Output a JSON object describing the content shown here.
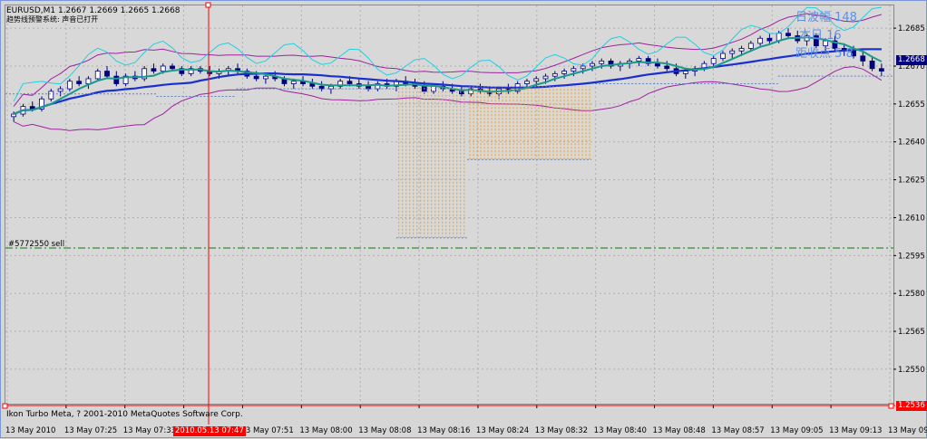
{
  "header": {
    "symbol_line": "EURUSD,M1  1.2667 1.2669 1.2665 1.2668",
    "indicator_line": "趋势线预警系统: 声音已打开"
  },
  "overlay_text": {
    "line1": "日波幅 148",
    "line2": "本日 16",
    "line3": "距收点 5 8"
  },
  "order_label": "#5772550 sell",
  "footer_text": "Ikon Turbo Meta, ? 2001-2010 MetaQuotes Software Corp.",
  "crosshair_time": "2010.05.13 07:47",
  "current_price_tag": "1.2668",
  "cursor_price_tag": "1.2536",
  "colors": {
    "candle_up_fill": "#ffffff",
    "candle_down_fill": "#000080",
    "candle_outline": "#000080",
    "ma_fast": "#1a9a8a",
    "ma_slow": "#1a2fd0",
    "bollinger": "#a020a0",
    "envelope_cyan": "#20d0e0",
    "dotted_orange": "#f0a020",
    "dotted_blue": "#6080c0",
    "order_line": "#008000",
    "crosshair": "#ff0000"
  },
  "chart_data": {
    "type": "candlestick",
    "title": "EURUSD,M1",
    "ylim": [
      1.2536,
      1.2694
    ],
    "y_ticks": [
      "1.2685",
      "1.2670",
      "1.2655",
      "1.2640",
      "1.2625",
      "1.2610",
      "1.2595",
      "1.2580",
      "1.2565",
      "1.2550"
    ],
    "x_ticks": [
      "13 May 2010",
      "13 May 07:25",
      "13 May 07:33",
      "13 May 07:42",
      "13 May 07:51",
      "13 May 08:00",
      "13 May 08:08",
      "13 May 08:16",
      "13 May 08:24",
      "13 May 08:32",
      "13 May 08:40",
      "13 May 08:48",
      "13 May 08:57",
      "13 May 09:05",
      "13 May 09:13",
      "13 May 09:21"
    ],
    "order_sell_price": 1.2598,
    "candles": [
      [
        1.265,
        1.2652,
        1.2648,
        1.2651
      ],
      [
        1.2651,
        1.2655,
        1.265,
        1.2654
      ],
      [
        1.2654,
        1.2656,
        1.2652,
        1.2653
      ],
      [
        1.2653,
        1.2658,
        1.2652,
        1.2657
      ],
      [
        1.2657,
        1.2661,
        1.2656,
        1.266
      ],
      [
        1.266,
        1.2662,
        1.2658,
        1.2661
      ],
      [
        1.2661,
        1.2665,
        1.266,
        1.2664
      ],
      [
        1.2664,
        1.2666,
        1.2662,
        1.2663
      ],
      [
        1.2663,
        1.2666,
        1.2661,
        1.2665
      ],
      [
        1.2665,
        1.2669,
        1.2664,
        1.2668
      ],
      [
        1.2668,
        1.267,
        1.2665,
        1.2666
      ],
      [
        1.2666,
        1.2668,
        1.2662,
        1.2663
      ],
      [
        1.2663,
        1.2667,
        1.2662,
        1.2666
      ],
      [
        1.2666,
        1.2668,
        1.2664,
        1.2665
      ],
      [
        1.2665,
        1.267,
        1.2664,
        1.2669
      ],
      [
        1.2669,
        1.2671,
        1.2667,
        1.2668
      ],
      [
        1.2668,
        1.2671,
        1.2667,
        1.267
      ],
      [
        1.267,
        1.2671,
        1.2668,
        1.2669
      ],
      [
        1.2669,
        1.267,
        1.2666,
        1.2667
      ],
      [
        1.2667,
        1.267,
        1.2666,
        1.2669
      ],
      [
        1.2669,
        1.267,
        1.2667,
        1.2668
      ],
      [
        1.2668,
        1.267,
        1.2666,
        1.2667
      ],
      [
        1.2667,
        1.2669,
        1.2665,
        1.2668
      ],
      [
        1.2668,
        1.267,
        1.2666,
        1.2669
      ],
      [
        1.2669,
        1.2671,
        1.2667,
        1.2668
      ],
      [
        1.2668,
        1.2669,
        1.2665,
        1.2666
      ],
      [
        1.2666,
        1.2668,
        1.2664,
        1.2665
      ],
      [
        1.2665,
        1.2667,
        1.2663,
        1.2666
      ],
      [
        1.2666,
        1.2668,
        1.2664,
        1.2665
      ],
      [
        1.2665,
        1.2666,
        1.2662,
        1.2663
      ],
      [
        1.2663,
        1.2665,
        1.2661,
        1.2664
      ],
      [
        1.2664,
        1.2666,
        1.2662,
        1.2663
      ],
      [
        1.2663,
        1.2665,
        1.2661,
        1.2662
      ],
      [
        1.2662,
        1.2664,
        1.266,
        1.2661
      ],
      [
        1.2661,
        1.2663,
        1.2659,
        1.2662
      ],
      [
        1.2662,
        1.2665,
        1.2661,
        1.2664
      ],
      [
        1.2664,
        1.2666,
        1.2662,
        1.2663
      ],
      [
        1.2663,
        1.2665,
        1.2661,
        1.2662
      ],
      [
        1.2662,
        1.2664,
        1.266,
        1.2661
      ],
      [
        1.2661,
        1.2664,
        1.266,
        1.2663
      ],
      [
        1.2663,
        1.2665,
        1.2661,
        1.2662
      ],
      [
        1.2662,
        1.2665,
        1.266,
        1.2664
      ],
      [
        1.2664,
        1.2666,
        1.2662,
        1.2663
      ],
      [
        1.2663,
        1.2665,
        1.2661,
        1.2662
      ],
      [
        1.2662,
        1.2664,
        1.2659,
        1.266
      ],
      [
        1.266,
        1.2663,
        1.2659,
        1.2662
      ],
      [
        1.2662,
        1.2664,
        1.266,
        1.2661
      ],
      [
        1.2661,
        1.2663,
        1.2659,
        1.266
      ],
      [
        1.266,
        1.2662,
        1.2658,
        1.2659
      ],
      [
        1.2659,
        1.2662,
        1.2658,
        1.2661
      ],
      [
        1.2661,
        1.2663,
        1.2659,
        1.266
      ],
      [
        1.266,
        1.2662,
        1.2658,
        1.2659
      ],
      [
        1.2659,
        1.2662,
        1.2657,
        1.2661
      ],
      [
        1.2661,
        1.2663,
        1.2659,
        1.266
      ],
      [
        1.266,
        1.2664,
        1.2659,
        1.2663
      ],
      [
        1.2663,
        1.2665,
        1.2661,
        1.2664
      ],
      [
        1.2664,
        1.2666,
        1.2662,
        1.2665
      ],
      [
        1.2665,
        1.2667,
        1.2663,
        1.2666
      ],
      [
        1.2666,
        1.2668,
        1.2664,
        1.2667
      ],
      [
        1.2667,
        1.2669,
        1.2665,
        1.2668
      ],
      [
        1.2668,
        1.267,
        1.2666,
        1.2669
      ],
      [
        1.2669,
        1.2671,
        1.2667,
        1.267
      ],
      [
        1.267,
        1.2672,
        1.2668,
        1.2671
      ],
      [
        1.2671,
        1.2673,
        1.2669,
        1.2672
      ],
      [
        1.2672,
        1.2673,
        1.2669,
        1.267
      ],
      [
        1.267,
        1.2672,
        1.2668,
        1.2671
      ],
      [
        1.2671,
        1.2673,
        1.2669,
        1.2672
      ],
      [
        1.2672,
        1.2674,
        1.267,
        1.2673
      ],
      [
        1.2673,
        1.2674,
        1.267,
        1.2671
      ],
      [
        1.2671,
        1.2673,
        1.2669,
        1.267
      ],
      [
        1.267,
        1.2672,
        1.2668,
        1.2669
      ],
      [
        1.2669,
        1.2671,
        1.2666,
        1.2667
      ],
      [
        1.2667,
        1.2669,
        1.2665,
        1.2668
      ],
      [
        1.2668,
        1.267,
        1.2666,
        1.2669
      ],
      [
        1.2669,
        1.2672,
        1.2668,
        1.2671
      ],
      [
        1.2671,
        1.2674,
        1.267,
        1.2673
      ],
      [
        1.2673,
        1.2676,
        1.2672,
        1.2675
      ],
      [
        1.2675,
        1.2677,
        1.2673,
        1.2676
      ],
      [
        1.2676,
        1.2678,
        1.2674,
        1.2677
      ],
      [
        1.2677,
        1.268,
        1.2676,
        1.2679
      ],
      [
        1.2679,
        1.2682,
        1.2678,
        1.2681
      ],
      [
        1.2681,
        1.2683,
        1.2679,
        1.268
      ],
      [
        1.268,
        1.2684,
        1.2679,
        1.2683
      ],
      [
        1.2683,
        1.2685,
        1.2681,
        1.2682
      ],
      [
        1.2682,
        1.2684,
        1.2679,
        1.268
      ],
      [
        1.268,
        1.2683,
        1.2678,
        1.2682
      ],
      [
        1.2682,
        1.2683,
        1.2677,
        1.2678
      ],
      [
        1.2678,
        1.2681,
        1.2676,
        1.268
      ],
      [
        1.268,
        1.2682,
        1.2676,
        1.2677
      ],
      [
        1.2677,
        1.2679,
        1.2674,
        1.2676
      ],
      [
        1.2676,
        1.2678,
        1.2673,
        1.2674
      ],
      [
        1.2674,
        1.2676,
        1.267,
        1.2672
      ],
      [
        1.2672,
        1.2674,
        1.2668,
        1.2669
      ],
      [
        1.2669,
        1.2671,
        1.2666,
        1.2668
      ]
    ]
  }
}
